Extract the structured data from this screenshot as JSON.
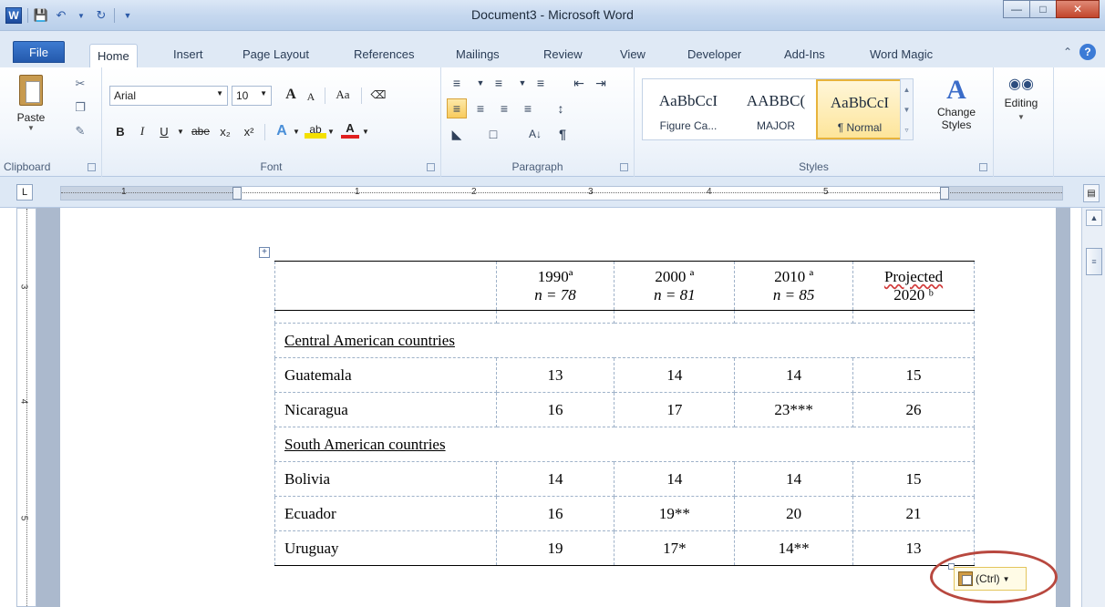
{
  "window": {
    "title": "Document3 - Microsoft Word",
    "word_logo": "W"
  },
  "qat": {
    "icons": [
      "save-icon",
      "undo-icon",
      "dropdown-icon",
      "redo-icon",
      "customize-icon"
    ]
  },
  "tabs": [
    {
      "label": "File"
    },
    {
      "label": "Home"
    },
    {
      "label": "Insert"
    },
    {
      "label": "Page Layout"
    },
    {
      "label": "References"
    },
    {
      "label": "Mailings"
    },
    {
      "label": "Review"
    },
    {
      "label": "View"
    },
    {
      "label": "Developer"
    },
    {
      "label": "Add-Ins"
    },
    {
      "label": "Word Magic"
    }
  ],
  "ribbon": {
    "clipboard": {
      "paste_label": "Paste",
      "group_label": "Clipboard"
    },
    "font": {
      "font_name": "Arial",
      "font_size": "10",
      "group_label": "Font",
      "grow_label": "A",
      "change_case_label": "Aa",
      "bold": "B",
      "italic": "I",
      "underline": "U",
      "strike": "abe",
      "subscript": "x₂",
      "superscript": "x²",
      "font_color": "A"
    },
    "paragraph": {
      "group_label": "Paragraph",
      "pilcrow": "¶"
    },
    "styles": {
      "group_label": "Styles",
      "items": [
        {
          "preview": "AaBbCcI",
          "name": "Figure Ca..."
        },
        {
          "preview": "AABBC(",
          "name": "MAJOR"
        },
        {
          "preview": "AaBbCcI",
          "name": "¶ Normal"
        }
      ],
      "change_styles_label": "Change Styles",
      "change_styles_icon": "A"
    },
    "editing": {
      "label": "Editing"
    }
  },
  "ruler": {
    "tab_selector": "L",
    "numbers": [
      "1",
      "1",
      "2",
      "3",
      "4",
      "5"
    ],
    "vertical_numbers": [
      "3",
      "4",
      "5"
    ]
  },
  "table": {
    "headers": [
      {
        "line1": "",
        "line2": ""
      },
      {
        "line1": "1990ª",
        "line2": "n = 78"
      },
      {
        "line1": "2000 ª",
        "line2": "n = 81"
      },
      {
        "line1": "2010 ª",
        "line2": "n = 85"
      },
      {
        "line1": "Projected",
        "line2": "2020 ᵇ"
      }
    ],
    "section_central": "Central American countries",
    "section_south": "South American countries",
    "rows": [
      {
        "country": "Guatemala",
        "v1990": "13",
        "v2000": "14",
        "v2010": "14",
        "v2020": "15"
      },
      {
        "country": "Nicaragua",
        "v1990": "16",
        "v2000": "17",
        "v2010": "23***",
        "v2020": "26"
      },
      {
        "country": "Bolivia",
        "v1990": "14",
        "v2000": "14",
        "v2010": "14",
        "v2020": "15"
      },
      {
        "country": "Ecuador",
        "v1990": "16",
        "v2000": "19**",
        "v2010": "20",
        "v2020": "21"
      },
      {
        "country": "Uruguay",
        "v1990": "19",
        "v2000": "17*",
        "v2010": "14**",
        "v2020": "13"
      }
    ]
  },
  "paste_options": {
    "label": "(Ctrl)"
  },
  "colors": {
    "file_tab": "#2459ac",
    "selected_style": "#fde59a",
    "highlight_ring": "#b8483f",
    "spell_squiggle": "#d23b3b"
  }
}
